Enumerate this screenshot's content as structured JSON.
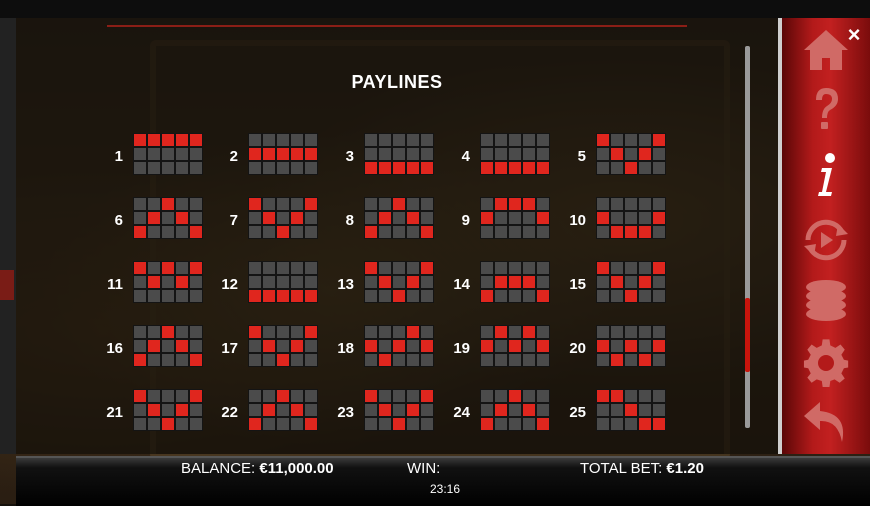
{
  "title": "PAYLINES",
  "close_symbol": "×",
  "paylines": [
    {
      "n": "1",
      "rows": [
        0,
        0,
        0,
        0,
        0
      ]
    },
    {
      "n": "2",
      "rows": [
        1,
        1,
        1,
        1,
        1
      ]
    },
    {
      "n": "3",
      "rows": [
        2,
        2,
        2,
        2,
        2
      ]
    },
    {
      "n": "4",
      "rows": [
        2,
        2,
        2,
        2,
        2
      ]
    },
    {
      "n": "5",
      "rows": [
        0,
        1,
        2,
        1,
        0
      ]
    },
    {
      "n": "6",
      "rows": [
        2,
        1,
        0,
        1,
        2
      ]
    },
    {
      "n": "7",
      "rows": [
        0,
        1,
        2,
        1,
        0
      ]
    },
    {
      "n": "8",
      "rows": [
        2,
        1,
        0,
        1,
        2
      ]
    },
    {
      "n": "9",
      "rows": [
        1,
        0,
        0,
        0,
        1
      ]
    },
    {
      "n": "10",
      "rows": [
        1,
        2,
        2,
        2,
        1
      ]
    },
    {
      "n": "11",
      "rows": [
        0,
        1,
        0,
        1,
        0
      ]
    },
    {
      "n": "12",
      "rows": [
        2,
        2,
        2,
        2,
        2
      ]
    },
    {
      "n": "13",
      "rows": [
        0,
        1,
        2,
        1,
        0
      ]
    },
    {
      "n": "14",
      "rows": [
        2,
        1,
        1,
        1,
        2
      ]
    },
    {
      "n": "15",
      "rows": [
        0,
        1,
        2,
        1,
        0
      ]
    },
    {
      "n": "16",
      "rows": [
        2,
        1,
        0,
        1,
        2
      ]
    },
    {
      "n": "17",
      "rows": [
        0,
        1,
        2,
        1,
        0
      ]
    },
    {
      "n": "18",
      "rows": [
        1,
        2,
        1,
        0,
        1
      ]
    },
    {
      "n": "19",
      "rows": [
        1,
        0,
        1,
        0,
        1
      ]
    },
    {
      "n": "20",
      "rows": [
        1,
        2,
        1,
        2,
        1
      ]
    },
    {
      "n": "21",
      "rows": [
        0,
        1,
        2,
        1,
        0
      ]
    },
    {
      "n": "22",
      "rows": [
        2,
        1,
        0,
        1,
        2
      ]
    },
    {
      "n": "23",
      "rows": [
        0,
        1,
        2,
        1,
        0
      ]
    },
    {
      "n": "24",
      "rows": [
        2,
        1,
        0,
        1,
        2
      ]
    },
    {
      "n": "25",
      "rows": [
        0,
        0,
        1,
        2,
        2
      ]
    }
  ],
  "menu": {
    "items": [
      "home-icon",
      "help-icon",
      "info-icon",
      "autoplay-icon",
      "bet-coins-icon",
      "settings-icon",
      "back-icon"
    ],
    "active": "info-icon",
    "inactive_color": "#d06a66",
    "active_color": "#ffffff"
  },
  "bottom": {
    "balance_label": "BALANCE:",
    "balance_value": "€11,000.00",
    "win_label": "WIN:",
    "win_value": "",
    "total_bet_label": "TOTAL BET:",
    "total_bet_value": "€1.20",
    "clock": "23:16"
  },
  "colors": {
    "line_red": "#e0261e",
    "cell_grey": "#4b4b4b",
    "menu_red": "#c22020"
  }
}
